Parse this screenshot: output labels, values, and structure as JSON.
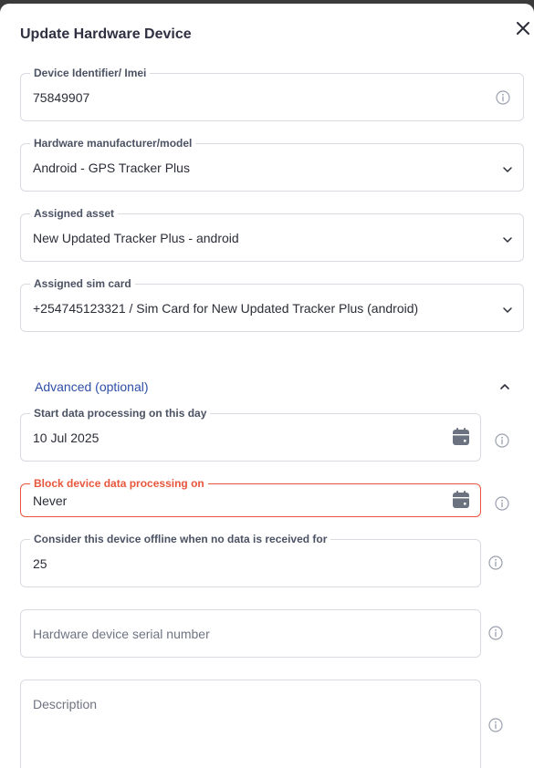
{
  "dialog": {
    "title": "Update Hardware Device"
  },
  "fields": {
    "imei": {
      "label": "Device Identifier/ Imei",
      "value": "75849907"
    },
    "model": {
      "label": "Hardware manufacturer/model",
      "value": "Android - GPS Tracker Plus"
    },
    "asset": {
      "label": "Assigned asset",
      "value": "New Updated Tracker Plus - android"
    },
    "sim": {
      "label": "Assigned sim card",
      "value": "+254745123321 / Sim Card for New Updated Tracker Plus (android)"
    }
  },
  "advanced": {
    "title": "Advanced (optional)",
    "start": {
      "label": "Start data processing on this day",
      "value": "10 Jul 2025"
    },
    "block": {
      "label": "Block device data processing on",
      "value": "Never"
    },
    "offline": {
      "label": "Consider this device offline when no data is received for",
      "value": "25"
    },
    "serial": {
      "placeholder": "Hardware device serial number"
    },
    "description": {
      "placeholder": "Description"
    }
  },
  "colors": {
    "accent": "#2f4fa8",
    "error": "#e8563c",
    "border": "#d9dbe1"
  },
  "icons": {
    "close": "close-icon",
    "info": "info-icon",
    "chevron": "chevron-down-icon",
    "calendar": "calendar-icon"
  }
}
